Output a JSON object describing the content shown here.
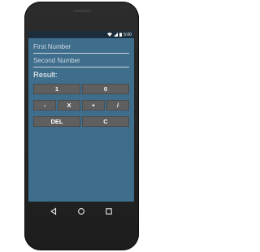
{
  "statusbar": {
    "time": "5:00"
  },
  "inputs": {
    "first_placeholder": "First Number",
    "second_placeholder": "Second Number"
  },
  "result_label": "Result:",
  "buttons": {
    "one": "1",
    "zero": "0",
    "minus": "-",
    "multiply": "X",
    "plus": "+",
    "divide": "/",
    "del": "DEL",
    "clear": "C"
  },
  "nav": {
    "back": "back-icon",
    "home": "home-icon",
    "recents": "recents-icon"
  },
  "colors": {
    "app_background": "#3f6d8c",
    "status_bar": "#1c2e3b",
    "button": "#5f5f5f"
  }
}
